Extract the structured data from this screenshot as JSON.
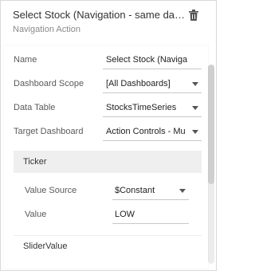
{
  "header": {
    "title": "Select Stock (Navigation - same dash...",
    "subtitle": "Navigation Action"
  },
  "form": {
    "name": {
      "label": "Name",
      "value": "Select Stock (Navigation -"
    },
    "dashboard_scope": {
      "label": "Dashboard Scope",
      "value": "[All Dashboards]"
    },
    "data_table": {
      "label": "Data Table",
      "value": "StocksTimeSeries"
    },
    "target_dashboard": {
      "label": "Target Dashboard",
      "value": "Action Controls - Multi"
    }
  },
  "parameters": [
    {
      "name": "Ticker",
      "value_source": {
        "label": "Value Source",
        "value": "$Constant"
      },
      "value": {
        "label": "Value",
        "value": "LOW"
      }
    },
    {
      "name": "SliderValue"
    }
  ],
  "colors": {
    "accent_text": "#333333",
    "muted_text": "#8a8a8a",
    "section_bg": "#efefef"
  },
  "icons": {
    "delete": "trash-icon",
    "dropdown": "chevron-down-icon"
  }
}
